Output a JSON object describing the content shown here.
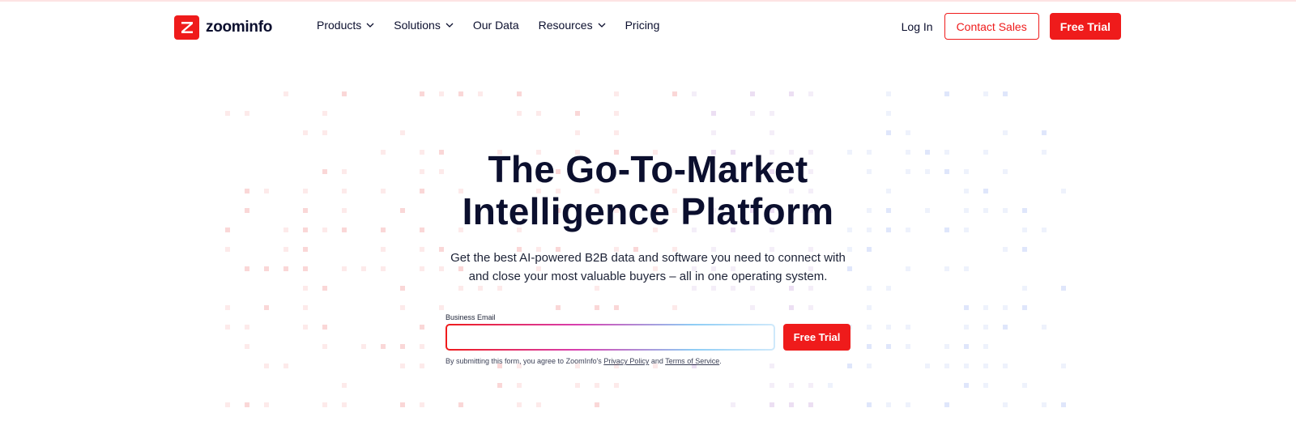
{
  "brand": {
    "name": "zoominfo",
    "accent": "#ef1b1b",
    "ink": "#0b0f2e"
  },
  "nav": {
    "items": [
      {
        "label": "Products",
        "dropdown": true
      },
      {
        "label": "Solutions",
        "dropdown": true
      },
      {
        "label": "Our Data",
        "dropdown": false
      },
      {
        "label": "Resources",
        "dropdown": true
      },
      {
        "label": "Pricing",
        "dropdown": false
      }
    ]
  },
  "header": {
    "login_label": "Log In",
    "contact_label": "Contact Sales",
    "trial_label": "Free Trial"
  },
  "hero": {
    "title_line1": "The Go-To-Market",
    "title_line2": "Intelligence Platform",
    "subtitle_line1": "Get the best AI-powered B2B data and software you need to connect with",
    "subtitle_line2": "and close your most valuable buyers – all in one operating system."
  },
  "form": {
    "email_label": "Business Email",
    "email_value": "",
    "email_placeholder": "",
    "submit_label": "Free Trial",
    "disclaimer_prefix": "By submitting this form, you agree to ZoomInfo's ",
    "privacy_label": "Privacy Policy",
    "disclaimer_and": " and ",
    "terms_label": "Terms of Service",
    "disclaimer_suffix": "."
  },
  "icons": {
    "logo": "zoominfo-z-logo-icon",
    "dropdown": "chevron-down-icon"
  }
}
